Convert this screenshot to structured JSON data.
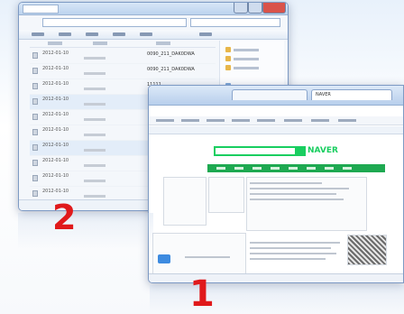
{
  "labels": {
    "explorer_window": "2",
    "browser_window": "1"
  },
  "explorer": {
    "tab_title": "",
    "address": "",
    "search_placeholder": "",
    "files": [
      {
        "date": "2012-01-10",
        "name": "0090_211_DAK0DWA"
      },
      {
        "date": "2012-01-10",
        "name": "0090_211_DAK0DWA"
      },
      {
        "date": "2012-01-10",
        "name": "11111"
      },
      {
        "date": "2012-01-10",
        "name": ""
      },
      {
        "date": "2012-01-10",
        "name": ""
      },
      {
        "date": "2012-01-10",
        "name": ""
      },
      {
        "date": "2012-01-10",
        "name": ""
      },
      {
        "date": "2012-01-10",
        "name": ""
      },
      {
        "date": "2012-01-10",
        "name": ""
      },
      {
        "date": "2012-01-10",
        "name": ""
      }
    ],
    "status": ""
  },
  "browser": {
    "tab1": "",
    "tab2": "NAVER",
    "menu": [
      "",
      "",
      "",
      "",
      "",
      ""
    ],
    "logo": "NAVER",
    "status": ""
  },
  "colors": {
    "accent_green": "#19ce60",
    "label_red": "#e0191b",
    "window_border": "#7d9ac4"
  }
}
